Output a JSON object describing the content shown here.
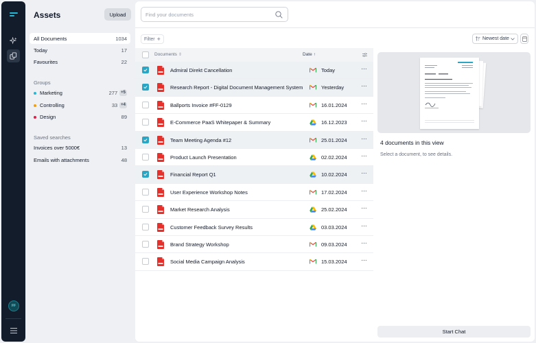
{
  "app": {
    "title": "Assets",
    "upload_label": "Upload",
    "avatar_initials": "FF",
    "accent": "#2aa6c4"
  },
  "nav": [
    {
      "label": "All Documents",
      "count": "1034"
    },
    {
      "label": "Today",
      "count": "17"
    },
    {
      "label": "Favourites",
      "count": "22"
    }
  ],
  "groups": {
    "label": "Groups",
    "items": [
      {
        "label": "Marketing",
        "count": "277",
        "badge": "+5",
        "color": "#27b6d4"
      },
      {
        "label": "Controlling",
        "count": "33",
        "badge": "+4",
        "color": "#f59e0b"
      },
      {
        "label": "Design",
        "count": "89",
        "badge": "",
        "color": "#e11d48"
      }
    ]
  },
  "saved": {
    "label": "Saved searches",
    "items": [
      {
        "label": "Invoices over 5000€",
        "count": "13"
      },
      {
        "label": "Emails with attachments",
        "count": "48"
      }
    ]
  },
  "search": {
    "placeholder": "Find your documents"
  },
  "toolbar": {
    "filter_label": "Filter",
    "sort_label": "Newest date"
  },
  "table": {
    "col_documents": "Documents",
    "col_date": "Date",
    "rows": [
      {
        "name": "Admiral Direkt Cancellation",
        "source": "gmail",
        "date": "Today",
        "checked": true
      },
      {
        "name": "Research Report - Digital Document Management System",
        "source": "gmail",
        "date": "Yesterday",
        "checked": true
      },
      {
        "name": "Ballports Invoice #FF-0129",
        "source": "gmail",
        "date": "16.01.2024",
        "checked": false
      },
      {
        "name": "E-Commerce PaaS Whitepaper & Summary",
        "source": "drive",
        "date": "16.12.2023",
        "checked": false
      },
      {
        "name": "Team Meeting Agenda #12",
        "source": "gmail",
        "date": "25.01.2024",
        "checked": true
      },
      {
        "name": "Product Launch Presentation",
        "source": "drive",
        "date": "02.02.2024",
        "checked": false
      },
      {
        "name": "Financial Report Q1",
        "source": "drive",
        "date": "10.02.2024",
        "checked": true
      },
      {
        "name": "User Experience Workshop Notes",
        "source": "gmail",
        "date": "17.02.2024",
        "checked": false
      },
      {
        "name": "Market Research Analysis",
        "source": "drive",
        "date": "25.02.2024",
        "checked": false
      },
      {
        "name": "Customer Feedback Survey Results",
        "source": "drive",
        "date": "03.03.2024",
        "checked": false
      },
      {
        "name": "Brand Strategy Workshop",
        "source": "gmail",
        "date": "09.03.2024",
        "checked": false
      },
      {
        "name": "Social Media Campaign Analysis",
        "source": "gmail",
        "date": "15.03.2024",
        "checked": false
      }
    ]
  },
  "details": {
    "title": "4 documents in this view",
    "subtitle": "Select a document, to see details.",
    "start_chat_label": "Start Chat"
  }
}
